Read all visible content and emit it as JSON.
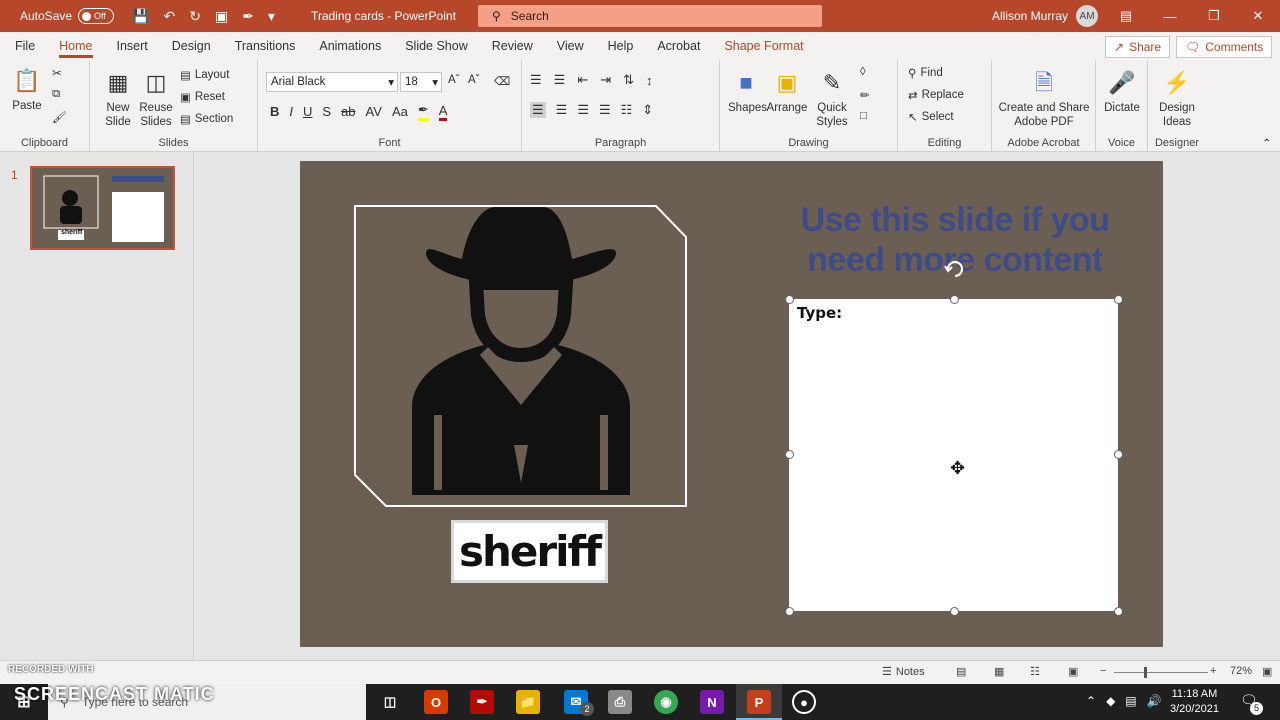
{
  "titlebar": {
    "autosave_label": "AutoSave",
    "autosave_state": "Off",
    "doc_title": "Trading cards - PowerPoint",
    "search_placeholder": "Search",
    "user_name": "Allison Murray",
    "user_initials": "AM"
  },
  "tabs": [
    "File",
    "Home",
    "Insert",
    "Design",
    "Transitions",
    "Animations",
    "Slide Show",
    "Review",
    "View",
    "Help",
    "Acrobat",
    "Shape Format"
  ],
  "active_tab": "Home",
  "share_label": "Share",
  "comments_label": "Comments",
  "ribbon": {
    "clipboard": {
      "label": "Clipboard",
      "paste": "Paste"
    },
    "slides": {
      "label": "Slides",
      "new_slide": "New Slide",
      "reuse_slides": "Reuse Slides",
      "layout": "Layout",
      "reset": "Reset",
      "section": "Section"
    },
    "font": {
      "label": "Font",
      "font_name": "Arial Black",
      "font_size": "18"
    },
    "paragraph": {
      "label": "Paragraph"
    },
    "drawing": {
      "label": "Drawing",
      "shapes": "Shapes",
      "arrange": "Arrange",
      "quick_styles": "Quick Styles"
    },
    "editing": {
      "label": "Editing",
      "find": "Find",
      "replace": "Replace",
      "select": "Select"
    },
    "adobe": {
      "label": "Adobe Acrobat",
      "create_share": "Create and Share Adobe PDF"
    },
    "voice": {
      "label": "Voice",
      "dictate": "Dictate"
    },
    "designer": {
      "label": "Designer",
      "design_ideas": "Design Ideas"
    }
  },
  "slide_panel": {
    "slide_number": "1",
    "thumb_label": "sheriff"
  },
  "slide": {
    "title": "Use this slide if you need more content",
    "textbox_text": "Type:",
    "card_label": "sheriff"
  },
  "statusbar": {
    "notes": "Notes",
    "zoom": "72%"
  },
  "taskbar": {
    "search_placeholder": "Type here to search",
    "time": "11:18 AM",
    "date": "3/20/2021",
    "mail_badge": "2",
    "notif_badge": "5"
  },
  "watermark": {
    "line1": "RECORDED WITH",
    "line2": "SCREENCAST MATIC"
  },
  "colors": {
    "accent": "#b7472a",
    "slide_bg": "#6b5e53",
    "title_text": "#3b4a8c"
  }
}
